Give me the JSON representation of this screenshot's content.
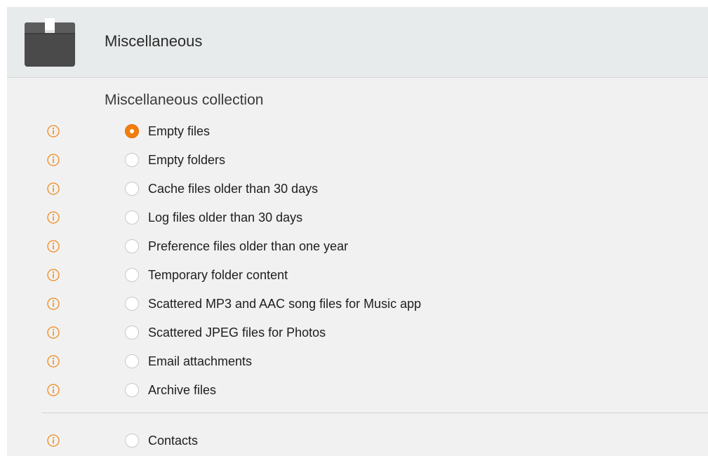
{
  "colors": {
    "accent": "#f27d0c",
    "info_icon": "#f08a1c",
    "header_bg": "#e8ebeb",
    "panel_bg": "#f1f1f1"
  },
  "header": {
    "icon": "box-icon",
    "title": "Miscellaneous"
  },
  "section": {
    "title": "Miscellaneous collection"
  },
  "options": [
    {
      "label": "Empty files",
      "selected": true
    },
    {
      "label": "Empty folders",
      "selected": false
    },
    {
      "label": "Cache files older than 30 days",
      "selected": false
    },
    {
      "label": "Log files older than 30 days",
      "selected": false
    },
    {
      "label": "Preference files older than one year",
      "selected": false
    },
    {
      "label": "Temporary folder content",
      "selected": false
    },
    {
      "label": "Scattered MP3 and AAC song files for Music app",
      "selected": false
    },
    {
      "label": "Scattered JPEG files for Photos",
      "selected": false
    },
    {
      "label": "Email attachments",
      "selected": false
    },
    {
      "label": "Archive files",
      "selected": false
    }
  ],
  "extra_options": [
    {
      "label": "Contacts",
      "selected": false
    }
  ]
}
